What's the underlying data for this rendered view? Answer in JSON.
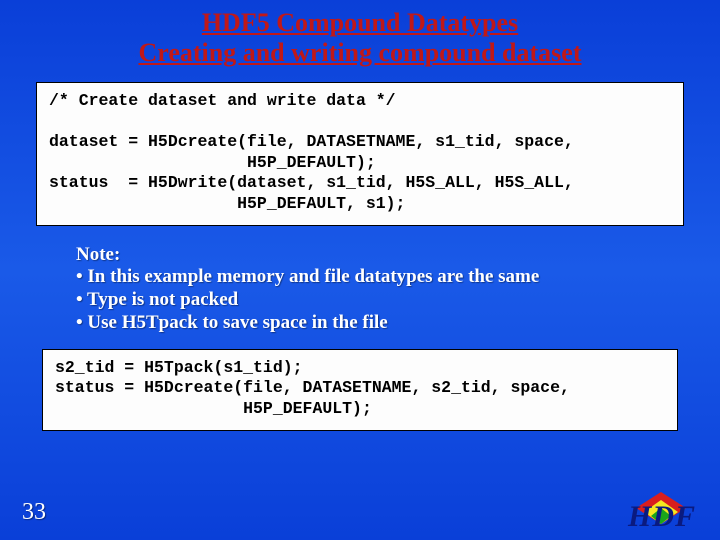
{
  "title": {
    "line1": "HDF5 Compound Datatypes",
    "line2": "Creating and writing compound dataset"
  },
  "code1": "/* Create dataset and write data */\n\ndataset = H5Dcreate(file, DATASETNAME, s1_tid, space,\n                    H5P_DEFAULT);\nstatus  = H5Dwrite(dataset, s1_tid, H5S_ALL, H5S_ALL,\n                   H5P_DEFAULT, s1);",
  "note": {
    "heading": "Note:",
    "bullet1": "• In this example memory and file datatypes are the same",
    "bullet2": "• Type is not packed",
    "bullet3": "• Use H5Tpack to save space in the file"
  },
  "code2": "s2_tid = H5Tpack(s1_tid);\nstatus = H5Dcreate(file, DATASETNAME, s2_tid, space,\n                   H5P_DEFAULT);",
  "slide_number": "33",
  "logo_text": "HDF"
}
